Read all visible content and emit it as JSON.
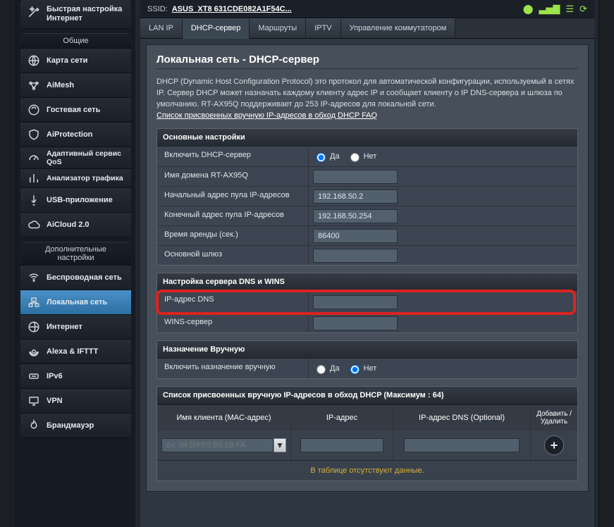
{
  "status": {
    "ssid_label": "SSID:",
    "ssid": "ASUS_XT8  631CDE082A1F54C..."
  },
  "sidebar": {
    "quick": {
      "l1": "Быстрая настройка",
      "l2": "Интернет"
    },
    "general": {
      "title": "Общие",
      "items": [
        {
          "label": "Карта сети"
        },
        {
          "label": "AiMesh"
        },
        {
          "label": "Гостевая сеть"
        },
        {
          "label": "AiProtection"
        },
        {
          "label": "Адаптивный сервис QoS"
        },
        {
          "label": "Анализатор трафика"
        },
        {
          "label": "USB-приложение"
        },
        {
          "label": "AiCloud 2.0"
        }
      ]
    },
    "advanced": {
      "title": "Дополнительные настройки",
      "items": [
        {
          "label": "Беспроводная сеть"
        },
        {
          "label": "Локальная сеть"
        },
        {
          "label": "Интернет"
        },
        {
          "label": "Alexa & IFTTT"
        },
        {
          "label": "IPv6"
        },
        {
          "label": "VPN"
        },
        {
          "label": "Брандмауэр"
        }
      ]
    }
  },
  "tabs": [
    "LAN IP",
    "DHCP-сервер",
    "Маршруты",
    "IPTV",
    "Управление коммутатором"
  ],
  "page": {
    "title": "Локальная сеть - DHCP-сервер",
    "desc": "DHCP (Dynamic Host Configuration Protocol) это протокол для автоматической конфигурации, используемый в сетях IP. Сервер DHCP может назначать каждому клиенту адрес IP и сообщает клиенту о IP DNS-сервера и шлюза по умолчанию. RT-AX95Q поддерживает до 253 IP-адресов для локальной сети.",
    "faq": "Список присвоенных вручную IP-адресов в обход DHCP FAQ"
  },
  "basic": {
    "header": "Основные настройки",
    "enable_label": "Включить DHCP-сервер",
    "yes": "Да",
    "no": "Нет",
    "domain_label": "Имя домена RT-AX95Q",
    "domain_value": "",
    "pool_start_label": "Начальный адрес пула IP-адресов",
    "pool_start": "192.168.50.2",
    "pool_end_label": "Конечный адрес пула IP-адресов",
    "pool_end": "192.168.50.254",
    "lease_label": "Время аренды (сек.)",
    "lease": "86400",
    "gateway_label": "Основной шлюз",
    "gateway": ""
  },
  "dns": {
    "header": "Настройка сервера DNS и WINS",
    "dns_label": "IP-адрес DNS",
    "dns_value": "",
    "wins_label": "WINS-сервер",
    "wins_value": ""
  },
  "manual": {
    "header": "Назначение Вручную",
    "enable_label": "Включить назначение вручную"
  },
  "list": {
    "header": "Список присвоенных вручную IP-адресов в обход DHCP (Максимум : 64)",
    "col_mac": "Имя клиента (MAC-адрес)",
    "col_ip": "IP-адрес",
    "col_dns": "IP-адрес DNS (Optional)",
    "col_act": "Добавить / Удалить",
    "mac_placeholder": "ex: 04:D9:F5:B5:1B:FA",
    "empty": "В таблице отсутствуют данные."
  }
}
